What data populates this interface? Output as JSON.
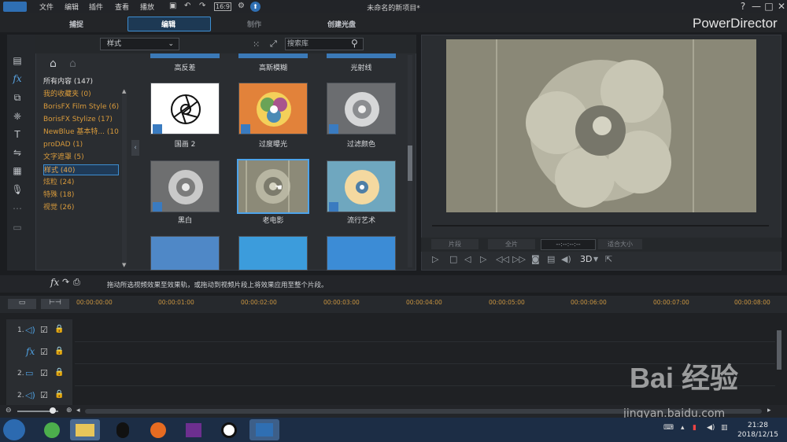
{
  "menu": [
    "文件",
    "编辑",
    "插件",
    "查看",
    "播放"
  ],
  "project_title": "未命名的新项目*",
  "window_buttons": [
    "?",
    "—",
    "□",
    "✕"
  ],
  "modes": [
    "捕捉",
    "编辑",
    "制作",
    "创建光盘"
  ],
  "brand": "PowerDirector",
  "library": {
    "dropdown": "样式",
    "search_placeholder": "搜索库",
    "categories": [
      "所有内容 (147)",
      "我的收藏夹 (0)",
      "BorisFX Film Style (6)",
      "BorisFX Stylize (17)",
      "NewBlue 基本特... (10)",
      "proDAD (1)",
      "文字遮罩 (5)",
      "样式 (40)",
      "炫粒 (24)",
      "特殊 (18)",
      "视觉 (26)"
    ],
    "top_labels": [
      "高反差",
      "高斯模糊",
      "光射线"
    ],
    "thumbs": [
      {
        "label": "国画 2"
      },
      {
        "label": "过度曝光"
      },
      {
        "label": "过滤颜色"
      },
      {
        "label": "黑白"
      },
      {
        "label": "老电影"
      },
      {
        "label": "流行艺术"
      }
    ]
  },
  "preview": {
    "btn_clip": "片段",
    "btn_movie": "全片",
    "timecode": "--:--:--:--",
    "fit": "适合大小",
    "threed": "3D"
  },
  "hint": "拖动所选视频效果至效果轨，或拖动到视频片段上将效果应用至整个片段。",
  "timeline": {
    "ticks": [
      "00:00:00:00",
      "00:00:01:00",
      "00:00:02:00",
      "00:00:03:00",
      "00:00:04:00",
      "00:00:05:00",
      "00:00:06:00",
      "00:00:07:00",
      "00:00:08:00"
    ],
    "tracks": [
      "1.",
      "",
      "2.",
      "2."
    ]
  },
  "clock": {
    "time": "21:28",
    "date": "2018/12/15"
  },
  "watermark": {
    "main": "Bai 经验",
    "sub": "jingyan.baidu.com"
  },
  "colors": {
    "accent": "#3d8ed1",
    "category": "#d89a3b",
    "taskbar": "#1c2d45"
  }
}
